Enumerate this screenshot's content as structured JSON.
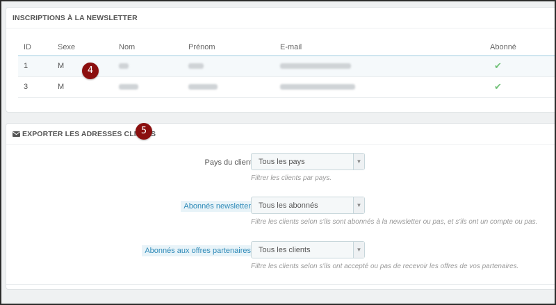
{
  "newsletter": {
    "title": "INSCRIPTIONS À LA NEWSLETTER",
    "columns": [
      "ID",
      "Sexe",
      "Nom",
      "Prénom",
      "E-mail",
      "Abonné"
    ],
    "rows": [
      {
        "id": "1",
        "sexe": "M",
        "subscribed": "✔"
      },
      {
        "id": "3",
        "sexe": "M",
        "subscribed": "✔"
      }
    ]
  },
  "export": {
    "title": "EXPORTER LES ADRESSES CLIENTS",
    "fields": [
      {
        "label": "Pays du client",
        "value": "Tous les pays",
        "help": "Filtrer les clients par pays."
      },
      {
        "label": "Abonnés newsletter",
        "value": "Tous les abonnés",
        "help": "Filtre les clients selon s'ils sont abonnés à la newsletter ou pas, et s'ils ont un compte ou pas."
      },
      {
        "label": "Abonnés aux offres partenaires",
        "value": "Tous les clients",
        "help": "Filtre les clients selon s'ils ont accepté ou pas de recevoir les offres de vos partenaires."
      }
    ]
  },
  "badges": [
    "4",
    "5"
  ],
  "colors": {
    "badge": "#8b0f0f",
    "check": "#72c279",
    "hint_text": "#2e8ab8"
  },
  "icons": {
    "heading": "envelope-icon",
    "select": "chevron-down-icon",
    "status": "check-icon"
  }
}
